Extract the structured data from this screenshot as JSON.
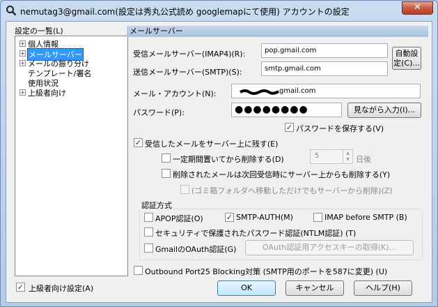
{
  "window": {
    "title": "nemutag3@gmail.com(設定は秀丸公式読め googlemapにて使用) アカウントの設定",
    "close_glyph": "✕"
  },
  "left_panel": {
    "list_label": "設定の一覧(L)",
    "tree": [
      {
        "label": "個人情報",
        "expandable": true
      },
      {
        "label": "メールサーバー",
        "expandable": true,
        "selected": true
      },
      {
        "label": "メールの振り分け",
        "expandable": true
      },
      {
        "label": "テンプレート/署名",
        "expandable": false
      },
      {
        "label": "使用状況",
        "expandable": false
      },
      {
        "label": "上級者向け",
        "expandable": true
      }
    ],
    "advanced_settings_label": "上級者向け設定(A)",
    "advanced_settings_checked": true
  },
  "section": {
    "header": "メールサーバー"
  },
  "server": {
    "imap_label": "受信メールサーバー(IMAP4)(R):",
    "imap_value": "pop.gmail.com",
    "smtp_label": "送信メールサーバー(SMTP)(S):",
    "smtp_value": "smtp.gmail.com",
    "auto_config_label": "自動設定(C)...",
    "account_label": "メール・アカウント(N):",
    "account_value": "gmail.com",
    "password_label": "パスワード(P):",
    "password_value": "●●●●●●●●",
    "show_password_button": "見ながら入力(I)...",
    "save_password_label": "パスワードを保存する(V)",
    "save_password_checked": true
  },
  "leave_on_server": {
    "label": "受信したメールをサーバー上に残す(E)",
    "checked": true,
    "delete_after_label": "一定期間置いてから削除する(D)",
    "delete_after_checked": false,
    "days_value": "5",
    "days_unit": "日後",
    "delete_when_deleted_label": "削除されたメールは次回受信時にサーバー上からも削除する(Y)",
    "delete_when_deleted_checked": false,
    "trash_move_label": "(ゴミ箱フォルダへ移動しただけでもサーバーから削除)(Z)",
    "trash_move_checked": false
  },
  "auth": {
    "group_label": "認証方式",
    "apop_label": "APOP認証(O)",
    "apop_checked": false,
    "smtp_auth_label": "SMTP-AUTH(M)",
    "smtp_auth_checked": true,
    "imap_before_smtp_label": "IMAP before SMTP (B)",
    "imap_before_smtp_checked": false,
    "ntlm_label": "セキュリティで保護されたパスワード認証(NTLM認証) (T)",
    "ntlm_checked": false,
    "gmail_oauth_label": "GmailのOAuth認証(G)",
    "gmail_oauth_checked": false,
    "oauth_key_button": "OAuth認証用アクセスキーの取得(K)..."
  },
  "port25": {
    "label": "Outbound Port25 Blocking対策 (SMTP用のポートを587に変更) (U)",
    "checked": false
  },
  "buttons": {
    "ok": "OK",
    "cancel": "キャンセル",
    "help": "ヘルプ(H)"
  },
  "check_glyph": "✓",
  "colors": {
    "selection": "#3399ff",
    "header_gradient_top": "#c7d7eb",
    "close_button": "#c75a41"
  }
}
